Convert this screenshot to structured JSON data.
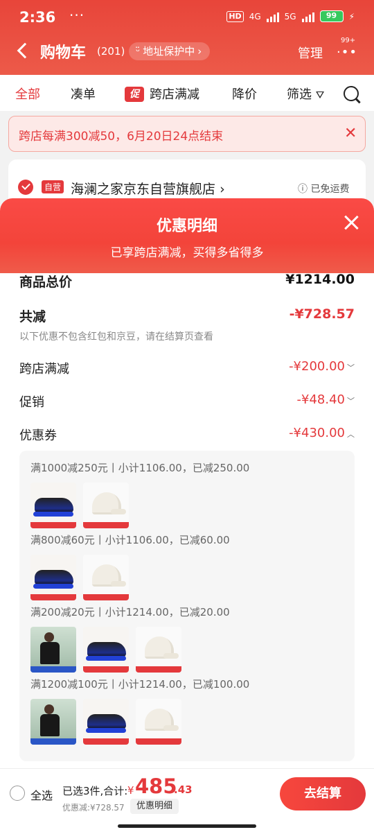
{
  "status": {
    "time": "2:36",
    "dots": "···",
    "hd": "HD",
    "net1": "4G",
    "net2": "5G",
    "battery": "99"
  },
  "header": {
    "title": "购物车",
    "count": "(201)",
    "address": "地址保护中",
    "manage": "管理",
    "badge": "99+"
  },
  "tabs": [
    {
      "label": "全部"
    },
    {
      "label": "凑单"
    },
    {
      "icon": "促",
      "label": "跨店满减"
    },
    {
      "label": "降价"
    },
    {
      "label": "筛选"
    }
  ],
  "promo": {
    "text": "跨店每满300减50，6月20日24点结束"
  },
  "shop": {
    "tag": "自营",
    "name": "海澜之家京东自营旗舰店",
    "shipping": "已免运费"
  },
  "sheet": {
    "title": "优惠明细",
    "subtitle": "已享跨店满减，买得多省得多",
    "rows": {
      "total": {
        "label": "商品总价",
        "value": "¥1214.00"
      },
      "reduce": {
        "label": "共减",
        "value": "-¥728.57",
        "note": "以下优惠不包含红包和京豆，请在结算页查看"
      },
      "crossstore": {
        "label": "跨店满减",
        "value": "-¥200.00"
      },
      "promotion": {
        "label": "促销",
        "value": "-¥48.40"
      },
      "coupon": {
        "label": "优惠券",
        "value": "-¥430.00"
      }
    },
    "coupons": [
      {
        "text": "满1000减250元丨小计1106.00，已减250.00",
        "items": [
          "shoe",
          "cap"
        ]
      },
      {
        "text": "满800减60元丨小计1106.00，已减60.00",
        "items": [
          "shoe",
          "cap"
        ]
      },
      {
        "text": "满200减20元丨小计1214.00，已减20.00",
        "items": [
          "shirt",
          "shoe",
          "cap"
        ]
      },
      {
        "text": "满1200减100元丨小计1214.00，已减100.00",
        "items": [
          "shirt",
          "shoe",
          "cap"
        ]
      }
    ]
  },
  "bottom": {
    "select_all": "全选",
    "selected": "已选3件,合计:",
    "yen": "¥",
    "total_int": "485",
    "total_dec": ".43",
    "saved": "优惠减:¥728.57",
    "detail_btn": "优惠明细",
    "checkout": "去结算"
  },
  "colors": {
    "brand": "#e4393c",
    "header": "#e8453a"
  }
}
